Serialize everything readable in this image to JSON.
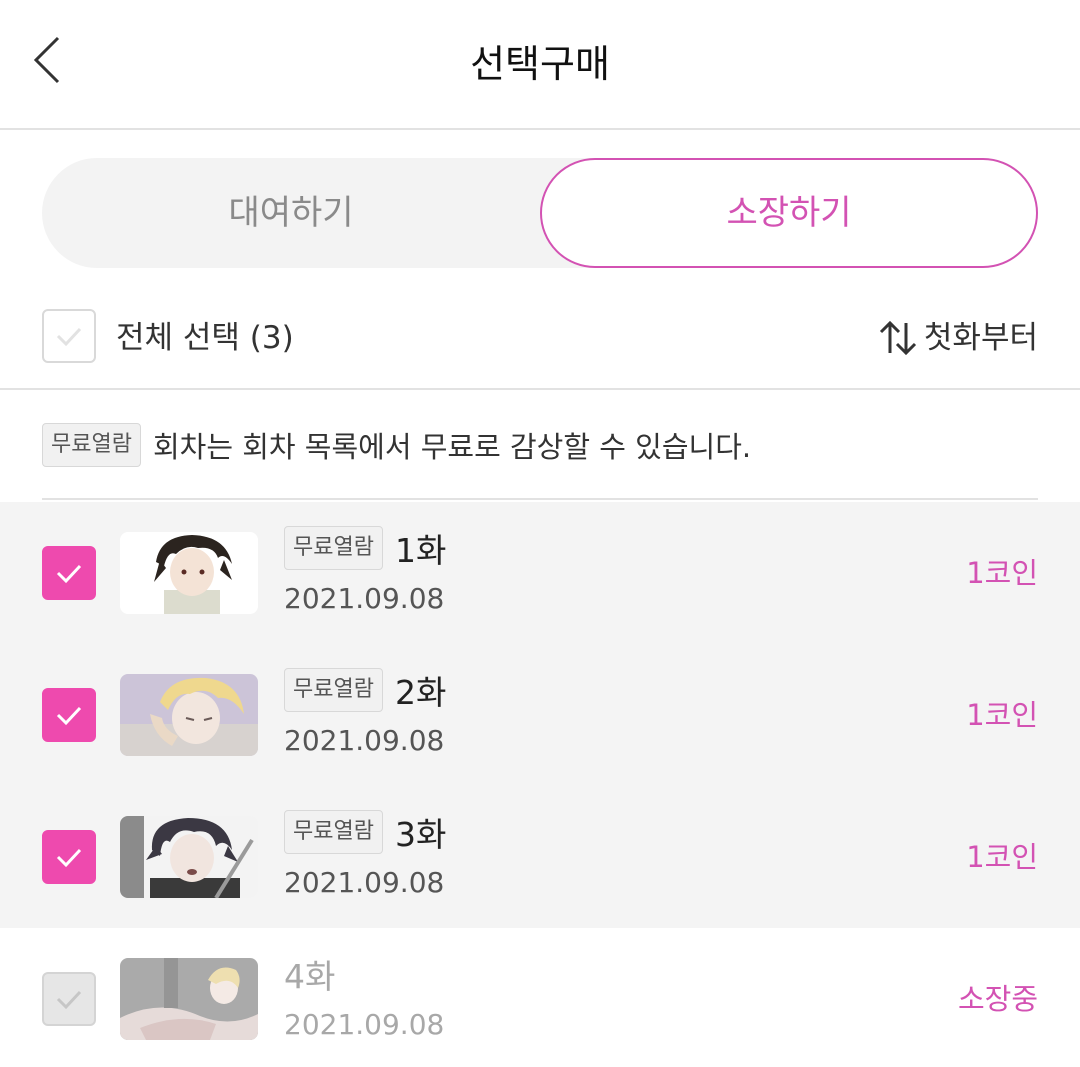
{
  "header": {
    "title": "선택구매",
    "back_icon": "chevron-left-icon"
  },
  "tabs": [
    {
      "label": "대여하기",
      "active": false
    },
    {
      "label": "소장하기",
      "active": true
    }
  ],
  "select_all": {
    "label": "전체 선택 (3)",
    "checked": false
  },
  "sort": {
    "label": "첫화부터",
    "icon": "sort-arrows-icon"
  },
  "notice": {
    "badge": "무료열람",
    "text": "회차는 회차 목록에서 무료로 감상할 수 있습니다."
  },
  "episodes": [
    {
      "badge": "무료열람",
      "title": "1화",
      "date": "2021.09.08",
      "price": "1코인",
      "checked": true,
      "disabled": false
    },
    {
      "badge": "무료열람",
      "title": "2화",
      "date": "2021.09.08",
      "price": "1코인",
      "checked": true,
      "disabled": false
    },
    {
      "badge": "무료열람",
      "title": "3화",
      "date": "2021.09.08",
      "price": "1코인",
      "checked": true,
      "disabled": false
    },
    {
      "badge": "",
      "title": "4화",
      "date": "2021.09.08",
      "price": "소장중",
      "checked": false,
      "disabled": true
    }
  ],
  "colors": {
    "accent": "#d352b3",
    "checkbox": "#ee4aae",
    "selected_row_bg": "#f4f4f4"
  }
}
